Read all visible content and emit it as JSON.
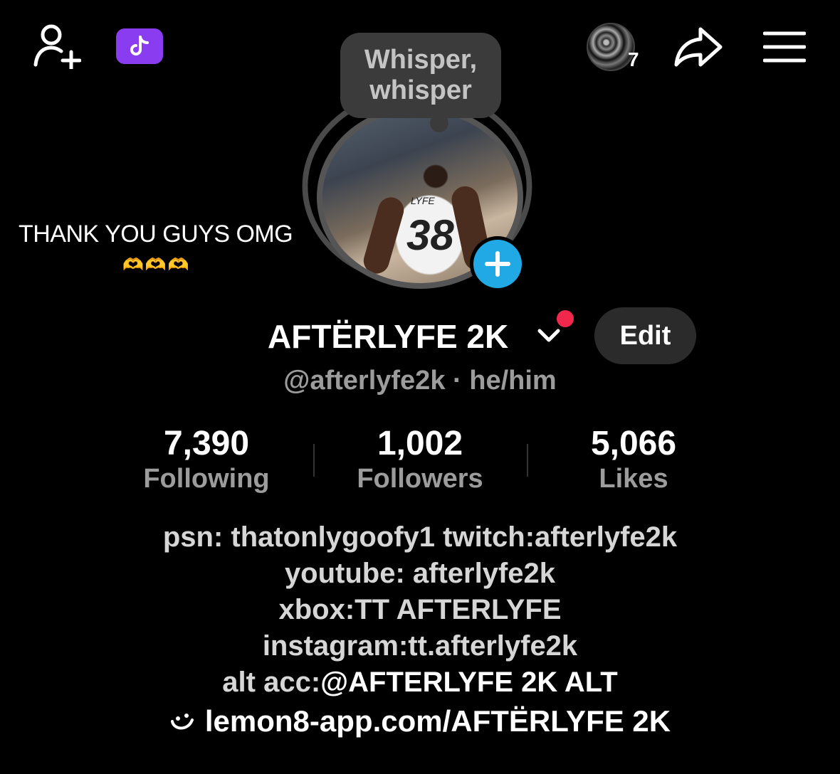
{
  "topbar": {
    "story_count": "7"
  },
  "whisper": {
    "line1": "Whisper,",
    "line2": "whisper"
  },
  "caption": {
    "text": "THANK YOU GUYS OMG",
    "emoji": "🫶🫶🫶"
  },
  "avatar": {
    "jersey_name": "LYFE",
    "jersey_number": "38"
  },
  "profile": {
    "display_name": "AFTËRLYFE 2K",
    "edit_label": "Edit",
    "handle": "@afterlyfe2k",
    "separator": "·",
    "pronouns": "he/him"
  },
  "stats": [
    {
      "value": "7,390",
      "label": "Following"
    },
    {
      "value": "1,002",
      "label": "Followers"
    },
    {
      "value": "5,066",
      "label": "Likes"
    }
  ],
  "bio": {
    "line1": "psn: thatonlygoofy1 twitch:afterlyfe2k",
    "line2": "youtube: afterlyfe2k",
    "line3": "xbox:TT AFTERLYFE",
    "line4": "instagram:tt.afterlyfe2k",
    "line5_prefix": "alt acc:",
    "line5_mention": "@AFTERLYFE 2K ALT"
  },
  "link": {
    "url": "lemon8-app.com/AFTËRLYFE 2K"
  },
  "colors": {
    "background": "#000000",
    "accent_blue": "#21a9e6",
    "coin_purple": "#8a3cf0",
    "notification_red": "#f0284e"
  },
  "icons": [
    "add-friend-icon",
    "tiktok-coin-icon",
    "share-icon",
    "menu-icon",
    "chevron-down-icon",
    "plus-icon",
    "smile-link-icon"
  ]
}
